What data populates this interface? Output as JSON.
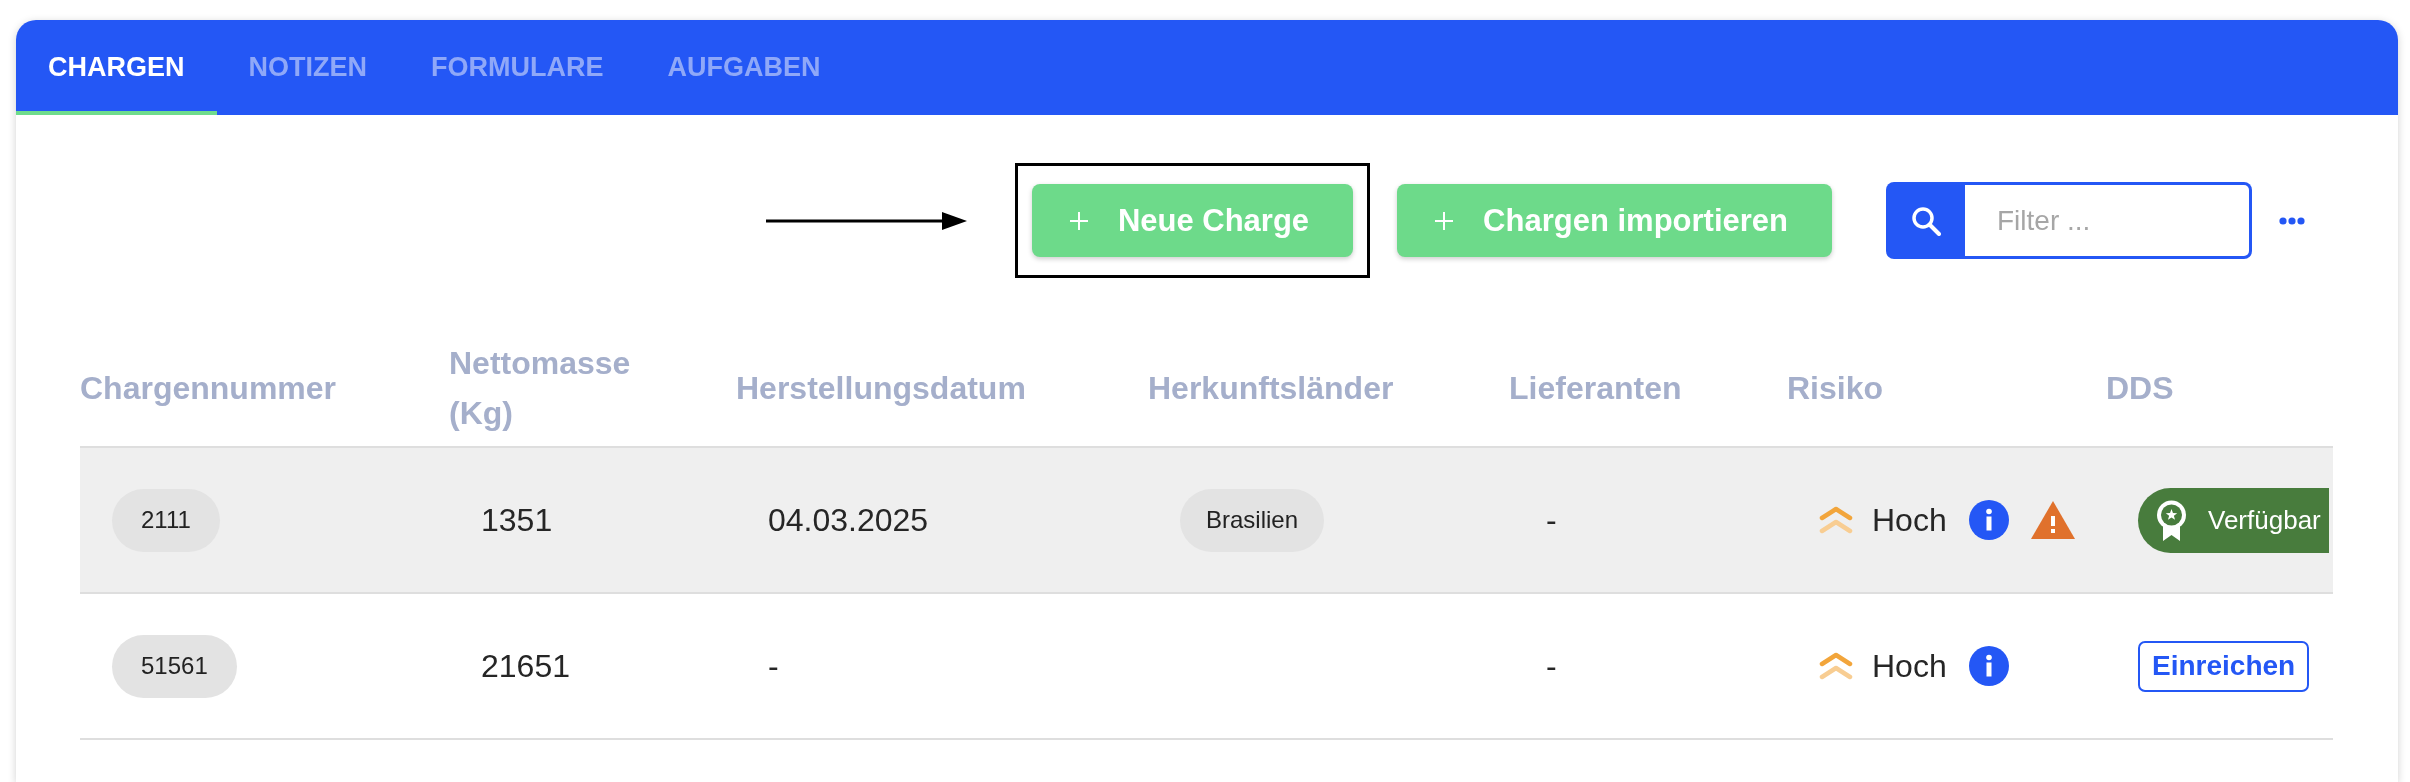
{
  "tabs": [
    {
      "label": "CHARGEN",
      "selected": true
    },
    {
      "label": "NOTIZEN",
      "selected": false
    },
    {
      "label": "FORMULARE",
      "selected": false
    },
    {
      "label": "AUFGABEN",
      "selected": false
    }
  ],
  "toolbar": {
    "buttons": [
      {
        "label": "Neue Charge",
        "highlighted": true
      },
      {
        "label": "Chargen importieren",
        "highlighted": false
      }
    ],
    "filter": {
      "placeholder": "Filter ..."
    }
  },
  "table": {
    "columns": [
      "Chargennummer",
      "Nettomasse (Kg)",
      "Herstellungsdatum",
      "Herkunftsländer",
      "Lieferanten",
      "Risiko",
      "DDS"
    ],
    "rows": [
      {
        "highlighted": true,
        "batch": "2111",
        "net_mass": "1351",
        "production_date": "04.03.2025",
        "countries": [
          "Brasilien"
        ],
        "suppliers": "-",
        "risk": {
          "label": "Hoch",
          "warning": true
        },
        "dds": {
          "kind": "badge",
          "label": "Verfügbar"
        }
      },
      {
        "highlighted": false,
        "batch": "51561",
        "net_mass": "21651",
        "production_date": "-",
        "suppliers": "-",
        "risk": {
          "label": "Hoch",
          "warning": false
        },
        "dds": {
          "kind": "button",
          "label": "Einreichen"
        }
      }
    ]
  }
}
